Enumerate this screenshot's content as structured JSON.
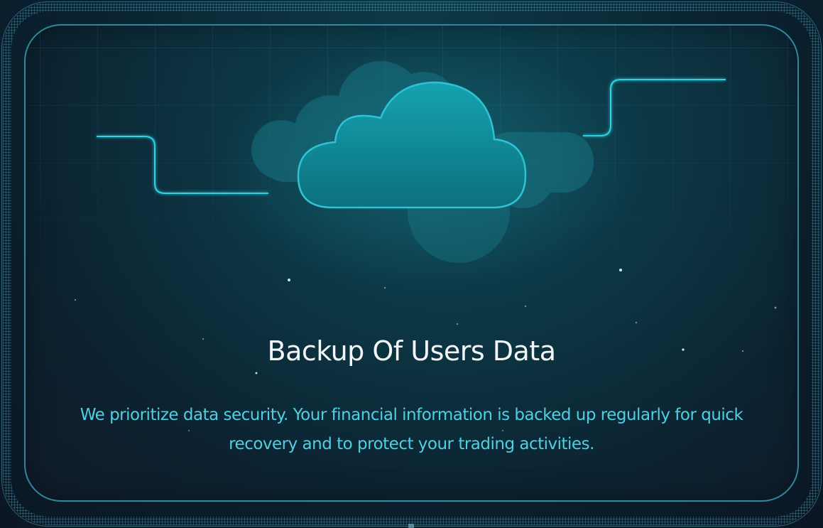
{
  "card": {
    "title": "Backup Of Users Data",
    "description": "We prioritize data security. Your financial information is backed up regularly for quick recovery and to protect your trading activities."
  },
  "illustration": {
    "icon": "cloud-icon",
    "accent_color": "#2fd4e6",
    "cloud_color": "#118a98"
  },
  "colors": {
    "title": "#f2f6f8",
    "description": "#4fd0e2",
    "border": "#3caac3",
    "background": "#0c2a38"
  }
}
